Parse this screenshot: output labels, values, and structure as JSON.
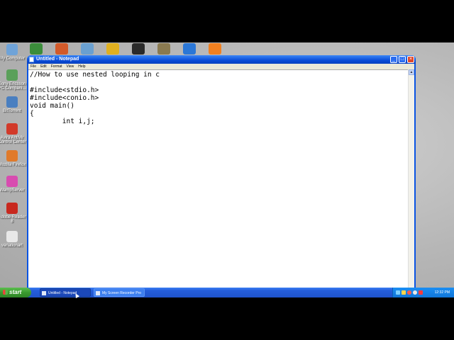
{
  "desktop": {
    "icons": [
      {
        "label": "My Computer",
        "color": "#6fa3d8"
      },
      {
        "label": "Sony Ericsson PC Compani...",
        "color": "#5aa05a"
      },
      {
        "label": "BitTorrent",
        "color": "#4a7fc0"
      },
      {
        "label": "Avira AntiVir Control Center",
        "color": "#d23a2a"
      },
      {
        "label": "Mozilla Firefox",
        "color": "#e07a2a"
      },
      {
        "label": "WampServer",
        "color": "#d84cb0"
      },
      {
        "label": "Adobe Reader 8",
        "color": "#c8281e"
      },
      {
        "label": "variationart",
        "color": "#e8e8e8"
      }
    ],
    "quick_launch_colors": [
      "#3b8d3b",
      "#d25a2a",
      "#6aa0d0",
      "#e0b020",
      "#2a2a2a",
      "#8a7a50",
      "#2b77d6",
      "#f08020"
    ]
  },
  "window": {
    "title": "Untitled - Notepad",
    "menu": [
      "File",
      "Edit",
      "Format",
      "View",
      "Help"
    ],
    "code_lines": [
      "//How to use nested looping in c",
      "",
      "#include<stdio.h>",
      "#include<conio.h>",
      "void main()",
      "{",
      "        int i,j;"
    ]
  },
  "taskbar": {
    "start_label": "start",
    "tasks": [
      {
        "label": "Untitled - Notepad",
        "active": true
      },
      {
        "label": "My Screen Recorder Pro",
        "active": false
      }
    ],
    "clock": "12:32 PM"
  }
}
